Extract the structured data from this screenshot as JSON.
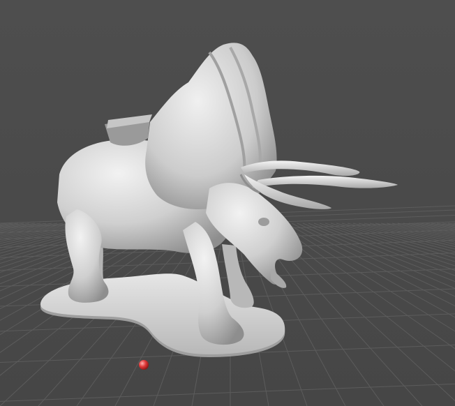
{
  "viewport": {
    "background": "#4a4a4a",
    "grid_color": "#5e5e5e",
    "model_color": "#d8d8d8",
    "model_shadow_color": "#9a9a9a",
    "pivot_color": "#e03a3a"
  },
  "scene": {
    "model": "triceratops-figurine",
    "base": "display-base",
    "pivot_marker": "pivot-marker",
    "grid": "ground-grid"
  }
}
